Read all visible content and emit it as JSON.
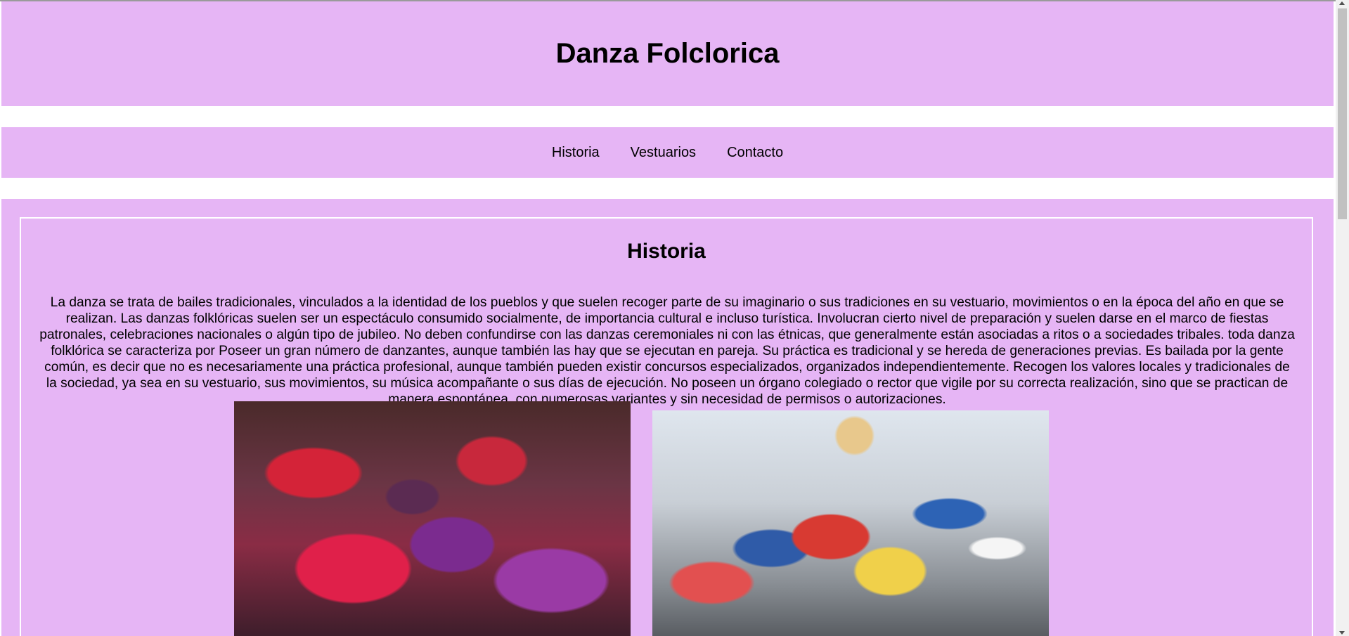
{
  "header": {
    "title": "Danza Folclorica"
  },
  "nav": {
    "items": [
      {
        "label": "Historia"
      },
      {
        "label": "Vestuarios"
      },
      {
        "label": "Contacto"
      }
    ]
  },
  "main": {
    "section_title": "Historia",
    "paragraph": "La danza se trata de bailes tradicionales, vinculados a la identidad de los pueblos y que suelen recoger parte de su imaginario o sus tradiciones en su vestuario, movimientos o en la época del año en que se realizan. Las danzas folklóricas suelen ser un espectáculo consumido socialmente, de importancia cultural e incluso turística. Involucran cierto nivel de preparación y suelen darse en el marco de fiestas patronales, celebraciones nacionales o algún tipo de jubileo. No deben confundirse con las danzas ceremoniales ni con las étnicas, que generalmente están asociadas a ritos o a sociedades tribales. toda danza folklórica se caracteriza por Poseer un gran número de danzantes, aunque también las hay que se ejecutan en pareja. Su práctica es tradicional y se hereda de generaciones previas. Es bailada por la gente común, es decir que no es necesariamente una práctica profesional, aunque también pueden existir concursos especializados, organizados independientemente. Recogen los valores locales y tradicionales de la sociedad, ya sea en su vestuario, sus movimientos, su música acompañante o sus días de ejecución. No poseen un órgano colegiado o rector que vigile por su correcta realización, sino que se practican de manera espontánea, con numerosas variantes y sin necesidad de permisos o autorizaciones."
  },
  "colors": {
    "panel_background": "#e6b5f5",
    "page_background": "#ffffff",
    "text": "#000000"
  }
}
